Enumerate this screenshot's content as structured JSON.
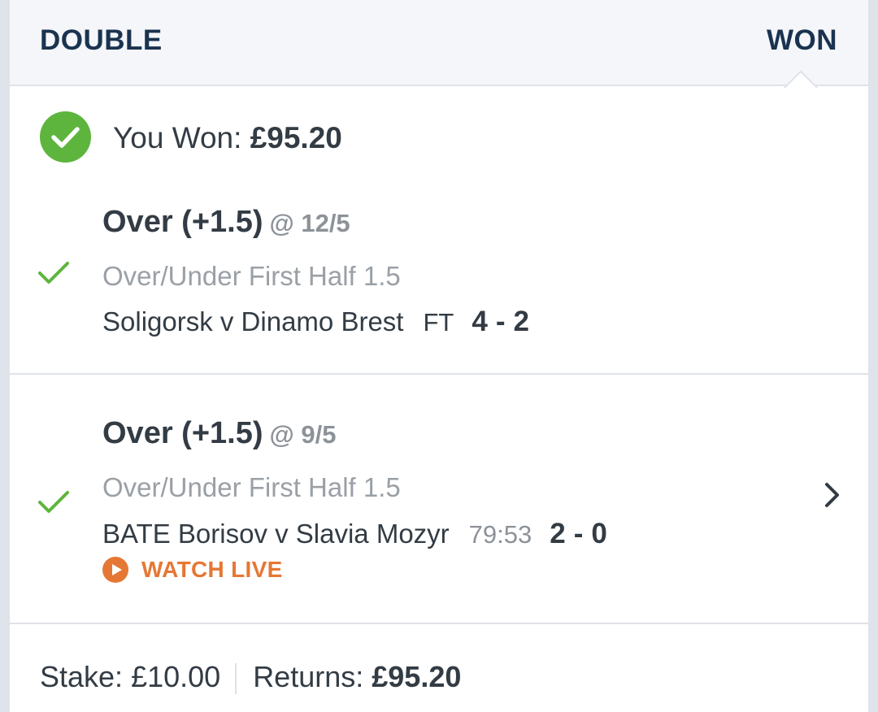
{
  "header": {
    "bet_type": "DOUBLE",
    "status": "WON"
  },
  "result": {
    "label": "You Won:",
    "amount": "£95.20"
  },
  "legs": [
    {
      "selection": "Over (+1.5)",
      "odds": "@ 12/5",
      "market": "Over/Under First Half 1.5",
      "event": "Soligorsk v Dinamo Brest",
      "clock": "FT",
      "score_home": "4",
      "score_away": "2"
    },
    {
      "selection": "Over (+1.5)",
      "odds": "@ 9/5",
      "market": "Over/Under First Half 1.5",
      "event": "BATE Borisov v Slavia Mozyr",
      "clock": "79:53",
      "score_home": "2",
      "score_away": "0",
      "watch_live": "WATCH LIVE"
    }
  ],
  "footer": {
    "stake_label": "Stake:",
    "stake": "£10.00",
    "returns_label": "Returns:",
    "returns": "£95.20"
  },
  "colors": {
    "won_green": "#5db53d",
    "header_navy": "#1a3350",
    "live_orange": "#e57734",
    "text_dark": "#333c44",
    "text_grey": "#9aa0a6"
  },
  "icons": [
    "check-circle-icon",
    "check-icon",
    "play-circle-icon",
    "chevron-right-icon"
  ]
}
